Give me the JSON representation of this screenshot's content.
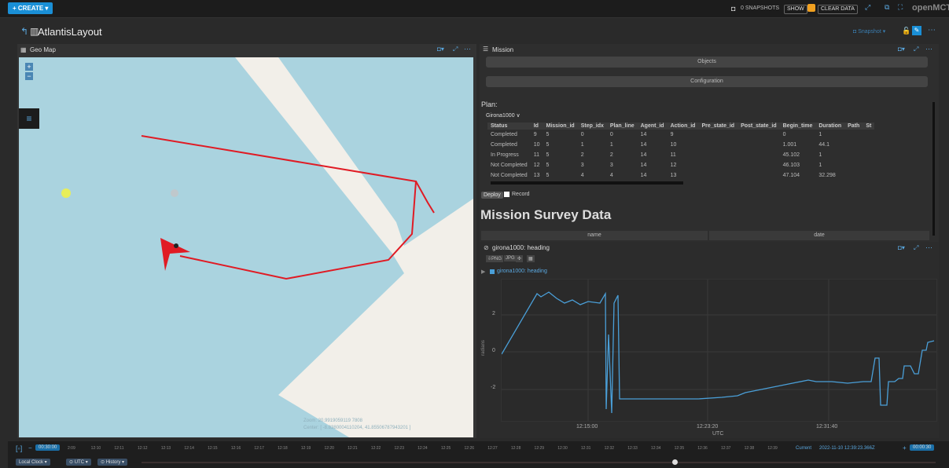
{
  "topbar": {
    "create_label": "CREATE",
    "snapshots_label": "0 SNAPSHOTS",
    "show_label": "SHOW",
    "clear_data_label": "CLEAR DATA",
    "brand_label": "openMCT"
  },
  "layout": {
    "title": "AtlantisLayout",
    "snapshot_label": "Snapshot"
  },
  "geo_map": {
    "title": "Geo Map",
    "zoom_label": "Zoom: 20.9919059119 7808",
    "center_label": "Center: [ -8.8380004110204, 41.85506787943201 ]",
    "colors": {
      "water": "#aad3df",
      "land": "#f2efe9",
      "track": "#e01b24",
      "marker_yellow": "#e8ee5a"
    }
  },
  "mission": {
    "title": "Mission",
    "objects_label": "Objects",
    "configuration_label": "Configuration",
    "plan_label": "Plan:",
    "plan_select": "Girona1000",
    "columns": [
      "Status",
      "Id",
      "Mission_id",
      "Step_idx",
      "Plan_line",
      "Agent_id",
      "Action_id",
      "Pre_state_id",
      "Post_state_id",
      "Begin_time",
      "Duration",
      "Path",
      "St"
    ],
    "rows": [
      [
        "Completed",
        "9",
        "5",
        "0",
        "0",
        "14",
        "9",
        "",
        "",
        "0",
        "1",
        "",
        ""
      ],
      [
        "Completed",
        "10",
        "5",
        "1",
        "1",
        "14",
        "10",
        "",
        "",
        "1.001",
        "44.1",
        "",
        ""
      ],
      [
        "In Progress",
        "11",
        "5",
        "2",
        "2",
        "14",
        "11",
        "",
        "",
        "45.102",
        "1",
        "",
        ""
      ],
      [
        "Not Completed",
        "12",
        "5",
        "3",
        "3",
        "14",
        "12",
        "",
        "",
        "46.103",
        "1",
        "",
        ""
      ],
      [
        "Not Completed",
        "13",
        "5",
        "4",
        "4",
        "14",
        "13",
        "",
        "",
        "47.104",
        "32.298",
        "",
        ""
      ]
    ],
    "deploy_label": "Deploy",
    "record_label": "Record",
    "survey_title": "Mission Survey Data",
    "survey_columns": [
      "name",
      "date"
    ]
  },
  "plot": {
    "title": "girona1000: heading",
    "png_label": "PNG",
    "jpg_label": "JPG",
    "legend_label": "girona1000: heading",
    "yticks": [
      "2",
      "0",
      "-2"
    ],
    "ylabel": "radians",
    "xticks": [
      "12:15:00",
      "12:23:20",
      "12:31:40"
    ],
    "xlabel": "UTC",
    "line_color": "#4a9fd8"
  },
  "timeline": {
    "duration_label": "00:30:00",
    "ticks": [
      "2:09",
      "12:10",
      "12:11",
      "12:12",
      "12:13",
      "12:14",
      "12:15",
      "12:16",
      "12:17",
      "12:18",
      "12:19",
      "12:20",
      "12:21",
      "12:22",
      "12:23",
      "12:24",
      "12:25",
      "12:26",
      "12:27",
      "12:28",
      "12:29",
      "12:30",
      "12:31",
      "12:32",
      "12:33",
      "12:34",
      "12:35",
      "12:36",
      "12:37",
      "12:38",
      "12:39"
    ],
    "current_label": "Current",
    "current_value": "2022-11-10 12:39:23.366Z",
    "end_offset": "00:00:30",
    "clock_label": "Local Clock",
    "tz_label": "UTC",
    "history_label": "History"
  }
}
